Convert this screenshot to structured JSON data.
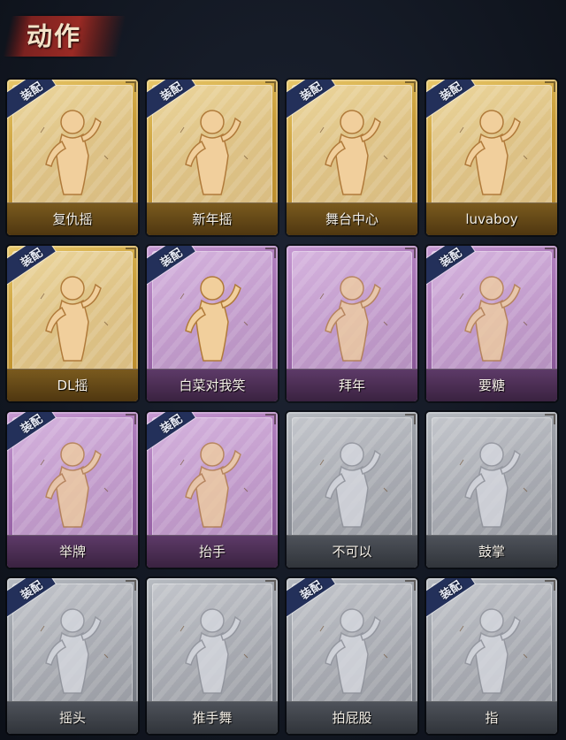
{
  "header": {
    "title": "动作"
  },
  "badge_label": "装配",
  "cards": [
    {
      "label": "复仇摇",
      "tier": "gold",
      "equipped": true,
      "icon": "dance-figure-raised-arm-icon"
    },
    {
      "label": "新年摇",
      "tier": "gold",
      "equipped": true,
      "icon": "dance-figure-clasped-hands-icon"
    },
    {
      "label": "舞台中心",
      "tier": "gold",
      "equipped": true,
      "icon": "dance-figure-pose-icon"
    },
    {
      "label": "luvaboy",
      "tier": "gold",
      "equipped": true,
      "icon": "dance-figure-cross-arm-icon"
    },
    {
      "label": "DL摇",
      "tier": "gold",
      "equipped": true,
      "icon": "dance-figure-arm-up-icon"
    },
    {
      "label": "白菜对我笑",
      "tier": "purple",
      "equipped": true,
      "icon": "figure-arms-crossed-icon"
    },
    {
      "label": "拜年",
      "tier": "purple",
      "equipped": false,
      "icon": "figure-bow-icon"
    },
    {
      "label": "要糖",
      "tier": "purple",
      "equipped": true,
      "icon": "figure-reach-icon"
    },
    {
      "label": "举牌",
      "tier": "purple",
      "equipped": true,
      "icon": "figure-holding-sign-icon"
    },
    {
      "label": "抬手",
      "tier": "purple",
      "equipped": true,
      "icon": "figure-raise-hand-icon"
    },
    {
      "label": "不可以",
      "tier": "silver",
      "equipped": false,
      "icon": "finger-wag-icon"
    },
    {
      "label": "鼓掌",
      "tier": "silver",
      "equipped": false,
      "icon": "clapping-hands-icon"
    },
    {
      "label": "摇头",
      "tier": "silver",
      "equipped": true,
      "icon": "figure-shake-head-icon"
    },
    {
      "label": "推手舞",
      "tier": "silver",
      "equipped": false,
      "icon": "figure-push-dance-icon"
    },
    {
      "label": "拍屁股",
      "tier": "silver",
      "equipped": true,
      "icon": "figure-pat-icon"
    },
    {
      "label": "指",
      "tier": "silver",
      "equipped": true,
      "icon": "pointing-hand-icon"
    }
  ]
}
